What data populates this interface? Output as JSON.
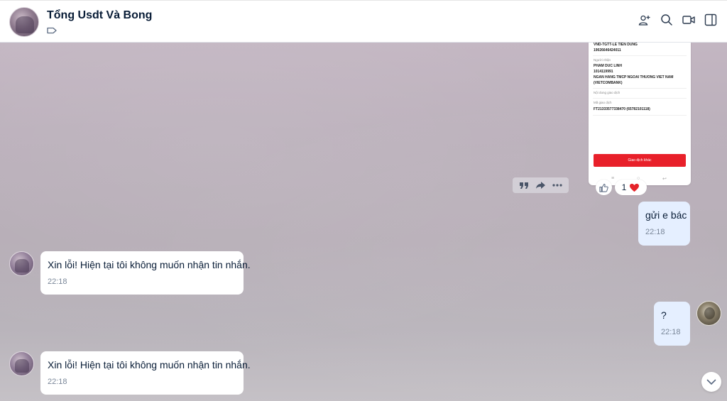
{
  "header": {
    "title": "Tổng Usdt Và Bong",
    "icons": [
      "tag-icon",
      "add-member-icon",
      "search-icon",
      "video-call-icon",
      "sidebar-toggle-icon"
    ]
  },
  "receipt": {
    "account_line": "VND-TGTT-LE TIEN DUNG",
    "account_number": "19026646424011",
    "receiver_label": "Người nhận",
    "receiver_name": "PHAM DUC LINH",
    "receiver_number": "1014119991",
    "bank_line1": "NGAN HANG TMCP NGOAI THUONG VIET NAM",
    "bank_line2": "(VIETCOMBANK)",
    "content_label": "Nội dung giao dịch",
    "code_label": "Mã giao dịch",
    "code_value": "FT21333577338470 (65782101118)",
    "button": "Giao dịch khác"
  },
  "message_actions": [
    "quote-icon",
    "forward-icon",
    "more-icon"
  ],
  "reactions": {
    "like_icon": "thumbs-up-icon",
    "count": "1",
    "reaction_icon": "heart-icon",
    "heart_color": "#e5242a"
  },
  "messages": [
    {
      "side": "out",
      "text": "gửi e bác",
      "time": "22:18"
    },
    {
      "side": "in",
      "text": "Xin lỗi! Hiện tại tôi không muốn nhận tin nhắn.",
      "time": "22:18"
    },
    {
      "side": "out",
      "text": "?",
      "time": "22:18"
    },
    {
      "side": "in",
      "text": "Xin lỗi! Hiện tại tôi không muốn nhận tin nhắn.",
      "time": "22:18"
    }
  ],
  "colors": {
    "accent": "#0068ff",
    "outgoing_bubble": "#e5efff",
    "incoming_bubble": "#ffffff",
    "text": "#081c36"
  }
}
